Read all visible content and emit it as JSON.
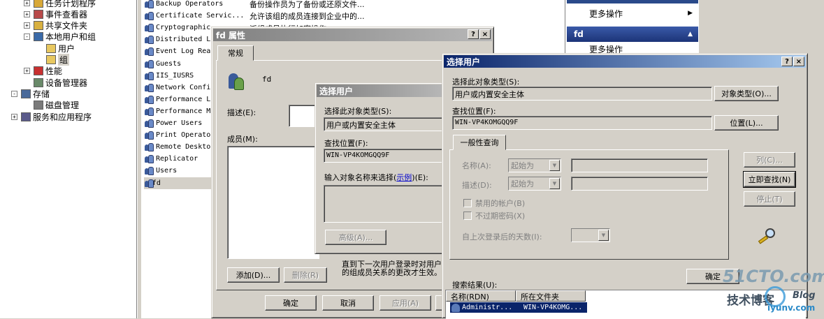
{
  "tree": {
    "items": [
      {
        "label": "任务计划程序",
        "expander": "+",
        "indent": 1
      },
      {
        "label": "事件查看器",
        "expander": "+",
        "indent": 1
      },
      {
        "label": "共享文件夹",
        "expander": "+",
        "indent": 1
      },
      {
        "label": "本地用户和组",
        "expander": "-",
        "indent": 1
      },
      {
        "label": "用户",
        "expander": "",
        "indent": 2
      },
      {
        "label": "组",
        "expander": "",
        "indent": 2
      },
      {
        "label": "性能",
        "expander": "+",
        "indent": 1
      },
      {
        "label": "设备管理器",
        "expander": "",
        "indent": 1
      },
      {
        "label": "存储",
        "expander": "-",
        "indent": 0
      },
      {
        "label": "磁盘管理",
        "expander": "",
        "indent": 1
      },
      {
        "label": "服务和应用程序",
        "expander": "+",
        "indent": 0
      }
    ]
  },
  "groups": {
    "rows": [
      {
        "name": "Backup Operators",
        "desc": "备份操作员为了备份或还原文件..."
      },
      {
        "name": "Certificate Servic...",
        "desc": "允许该组的成员连接到企业中的..."
      },
      {
        "name": "Cryptographic",
        "desc": ""
      },
      {
        "name": "Distributed L",
        "desc": ""
      },
      {
        "name": "Event Log Rea",
        "desc": ""
      },
      {
        "name": "Guests",
        "desc": ""
      },
      {
        "name": "IIS_IUSRS",
        "desc": ""
      },
      {
        "name": "Network Confi",
        "desc": ""
      },
      {
        "name": "Performance L",
        "desc": ""
      },
      {
        "name": "Performance M",
        "desc": ""
      },
      {
        "name": "Power Users",
        "desc": ""
      },
      {
        "name": "Print Operato",
        "desc": ""
      },
      {
        "name": "Remote Deskto",
        "desc": ""
      },
      {
        "name": "Replicator",
        "desc": ""
      },
      {
        "name": "Users",
        "desc": ""
      },
      {
        "name": "fd",
        "desc": ""
      }
    ],
    "partial_text": "派组成员执行加密操作"
  },
  "actions": {
    "more_actions_1": "更多操作",
    "section": "fd",
    "more_actions_2": "更多操作"
  },
  "props": {
    "title": "fd 属性",
    "tab": "常规",
    "group_name": "fd",
    "desc_label": "描述(E):",
    "members_label": "成员(M):",
    "add": "添加(D)...",
    "remove": "删除(R)",
    "note": "直到下一次用户登录时对用户的组成员关系的更改才生效。",
    "ok": "确定",
    "cancel": "取消",
    "apply": "应用(A)",
    "help_glyph": "?",
    "close_glyph": "×"
  },
  "sel_small": {
    "title": "选择用户",
    "type_label": "选择此对象类型(S):",
    "type_value": "用户或内置安全主体",
    "loc_label": "查找位置(F):",
    "loc_value": "WIN-VP4KOMGQQ9F",
    "enter_label": "输入对象名称来选择(",
    "example": "示例",
    "enter_label2": ")(E):",
    "advanced": "高级(A)..."
  },
  "sel_big": {
    "title": "选择用户",
    "type_label": "选择此对象类型(S):",
    "type_value": "用户或内置安全主体",
    "type_btn": "对象类型(O)...",
    "loc_label": "查找位置(F):",
    "loc_value": "WIN-VP4KOMGQQ9F",
    "loc_btn": "位置(L)...",
    "tab": "一般性查询",
    "name_label": "名称(A):",
    "desc_label": "描述(D):",
    "starts_with": "起始为",
    "disabled": "禁用的帐户(B)",
    "no_expire": "不过期密码(X)",
    "days_label": "自上次登录后的天数(I):",
    "col_btn": "列(C)...",
    "find_btn": "立即查找(N)",
    "stop_btn": "停止(T)",
    "ok": "确定",
    "results_label": "搜索结果(U):",
    "col_name": "名称(RDN)",
    "col_folder": "所在文件夹",
    "result_name": "Administr...",
    "result_folder": "WIN-VP4KOMG..."
  },
  "watermark": {
    "site": "51CTO.com",
    "sub": "技术博客",
    "blog": "Blog",
    "domain": "iyunv.com"
  }
}
